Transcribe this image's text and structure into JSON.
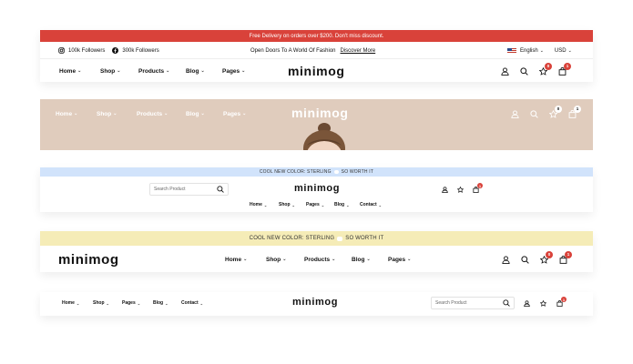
{
  "colors": {
    "promo_red": "#d9423a",
    "hero_beige": "#e0ccbd",
    "sky_blue": "#d1e3fb",
    "pale_yellow": "#f5ecb7",
    "badge_red": "#d9423a"
  },
  "header1": {
    "promo": "Free Delivery on orders over $200. Don't miss discount.",
    "social": [
      {
        "icon": "instagram-icon",
        "label": "100k Followers"
      },
      {
        "icon": "facebook-icon",
        "label": "300k Followers"
      }
    ],
    "tagline": "Open Doors To A World Of Fashion",
    "tagline_link": "Discover More",
    "language": "English",
    "currency": "USD",
    "nav": [
      "Home",
      "Shop",
      "Products",
      "Blog",
      "Pages"
    ],
    "logo": "minimog",
    "wishlist_count": "0",
    "cart_count": "1"
  },
  "header2": {
    "nav": [
      "Home",
      "Shop",
      "Products",
      "Blog",
      "Pages"
    ],
    "logo": "minimog",
    "wishlist_count": "0",
    "cart_count": "1"
  },
  "header3": {
    "announcement_left": "COOL NEW COLOR: STERLING",
    "announcement_right": "SO WORTH IT",
    "search_placeholder": "Search Product",
    "logo": "minimog",
    "cart_count": "1",
    "nav": [
      "Home",
      "Shop",
      "Pages",
      "Blog",
      "Contact"
    ]
  },
  "header4": {
    "announcement_left": "COOL NEW COLOR: STERLING",
    "announcement_right": "SO WORTH IT",
    "logo": "minimog",
    "nav": [
      "Home",
      "Shop",
      "Products",
      "Blog",
      "Pages"
    ],
    "wishlist_count": "0",
    "cart_count": "1"
  },
  "header5": {
    "nav": [
      "Home",
      "Shop",
      "Pages",
      "Blog",
      "Contact"
    ],
    "logo": "minimog",
    "search_placeholder": "Search Product",
    "cart_count": "1"
  }
}
